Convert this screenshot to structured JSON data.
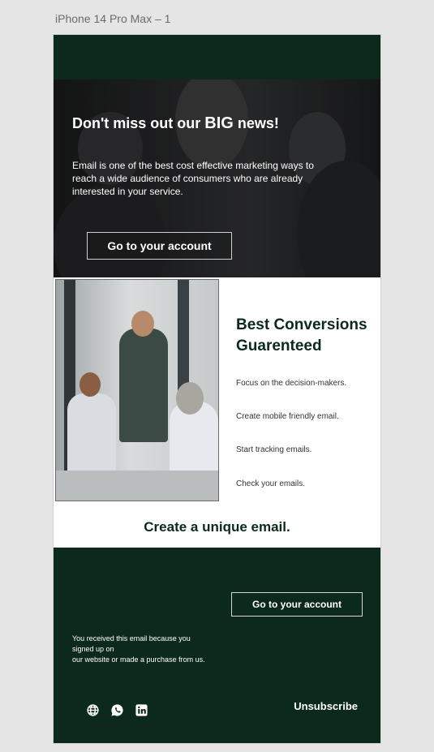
{
  "artboard": {
    "label": "iPhone 14 Pro Max – 1"
  },
  "hero": {
    "title_pre": "Don't miss out our ",
    "title_big": "BIG",
    "title_post": " news!",
    "body": "Email is one of the best cost effective marketing ways to reach a wide audience of consumers who are already interested in your service.",
    "button_label": "Go to your account"
  },
  "conversions": {
    "title": "Best Conversions Guarenteed",
    "items": [
      "Focus on the decision-makers.",
      "Create mobile friendly email.",
      "Start tracking emails.",
      "Check your emails."
    ]
  },
  "cta": {
    "text": "Create a unique email."
  },
  "footer": {
    "button_label": "Go to your account",
    "note_lines": [
      "You received this email because you",
      "signed up on",
      "our website or made a purchase from us."
    ],
    "social_icons": [
      "globe-icon",
      "whatsapp-icon",
      "linkedin-icon"
    ],
    "unsubscribe": "Unsubscribe"
  },
  "colors": {
    "brand_dark_green": "#0c2a1b",
    "text_dark": "#333333",
    "white": "#ffffff"
  }
}
